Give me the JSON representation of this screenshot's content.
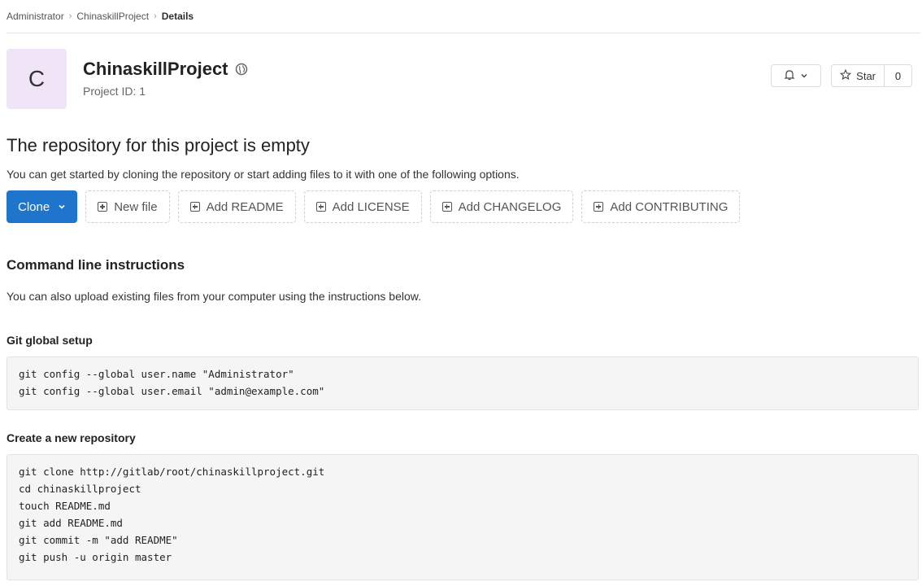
{
  "breadcrumb": {
    "items": [
      "Administrator",
      "ChinaskillProject",
      "Details"
    ]
  },
  "project": {
    "avatar_letter": "C",
    "title": "ChinaskillProject",
    "id_label": "Project ID: 1"
  },
  "actions": {
    "star_label": "Star",
    "star_count": "0"
  },
  "empty": {
    "title": "The repository for this project is empty",
    "description": "You can get started by cloning the repository or start adding files to it with one of the following options."
  },
  "buttons": {
    "clone": "Clone",
    "new_file": "New file",
    "add_readme": "Add README",
    "add_license": "Add LICENSE",
    "add_changelog": "Add CHANGELOG",
    "add_contributing": "Add CONTRIBUTING"
  },
  "instructions": {
    "title": "Command line instructions",
    "description": "You can also upload existing files from your computer using the instructions below.",
    "git_global_setup": {
      "label": "Git global setup",
      "lines": [
        "git config --global user.name \"Administrator\"",
        "git config --global user.email \"admin@example.com\""
      ]
    },
    "create_repo": {
      "label": "Create a new repository",
      "lines": [
        "git clone http://gitlab/root/chinaskillproject.git",
        "cd chinaskillproject",
        "touch README.md",
        "git add README.md",
        "git commit -m \"add README\"",
        "git push -u origin master"
      ]
    }
  },
  "colors": {
    "primary": "#1f75cb",
    "avatar_bg": "#f0e5f7",
    "code_bg": "#f5f5f5"
  }
}
